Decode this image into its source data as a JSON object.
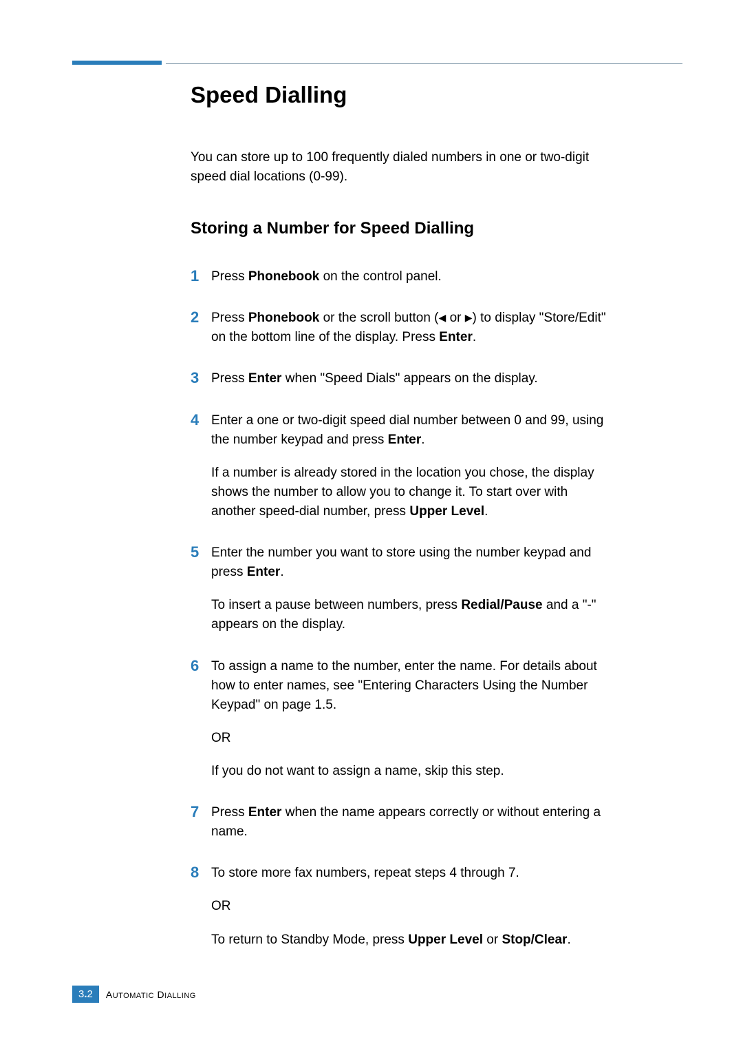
{
  "heading": "Speed Dialling",
  "intro": "You can store up to 100 frequently dialed numbers in one or two-digit speed dial locations (0-99).",
  "subheading": "Storing a Number for Speed Dialling",
  "steps": {
    "s1": {
      "num": "1",
      "a": "Press ",
      "b": "Phonebook",
      "c": " on the control panel."
    },
    "s2": {
      "num": "2",
      "a": "Press ",
      "b": "Phonebook",
      "c": " or the scroll button (",
      "left": "◀",
      "or": " or ",
      "right": "▶",
      "d": ") to display \"Store/Edit\" on the bottom line of the display. Press ",
      "e": "Enter",
      "f": "."
    },
    "s3": {
      "num": "3",
      "a": "Press ",
      "b": "Enter",
      "c": " when \"Speed Dials\" appears on the display."
    },
    "s4": {
      "num": "4",
      "p1a": "Enter a one or two-digit speed dial number between 0 and 99, using the number keypad and press ",
      "p1b": "Enter",
      "p1c": ".",
      "p2a": "If a number is already stored in the location you chose, the display shows the number to allow you to change it. To start over with another speed-dial number, press ",
      "p2b": "Upper Level",
      "p2c": "."
    },
    "s5": {
      "num": "5",
      "p1a": "Enter the number you want to store using the number keypad and press ",
      "p1b": "Enter",
      "p1c": ".",
      "p2a": "To insert a pause between numbers, press ",
      "p2b": "Redial/Pause",
      "p2c": " and a \"-\" appears on the display."
    },
    "s6": {
      "num": "6",
      "p1": "To assign a name to the number, enter the name. For details about how to enter names, see \"Entering Characters Using the Number Keypad\" on page 1.5.",
      "p2": "OR",
      "p3": "If you do not want to assign a name, skip this step."
    },
    "s7": {
      "num": "7",
      "a": "Press ",
      "b": "Enter",
      "c": " when the name appears correctly or without entering a name."
    },
    "s8": {
      "num": "8",
      "p1": "To store more fax numbers, repeat steps 4 through 7.",
      "p2": "OR",
      "p3a": "To return to Standby Mode, press ",
      "p3b": "Upper Level",
      "p3c": " or ",
      "p3d": "Stop/Clear",
      "p3e": "."
    }
  },
  "footer": {
    "chapter": "3",
    "page": "2",
    "label_first": "A",
    "label_rest_1": "UTOMATIC",
    "label_space": " D",
    "label_rest_2": "IALLING"
  }
}
